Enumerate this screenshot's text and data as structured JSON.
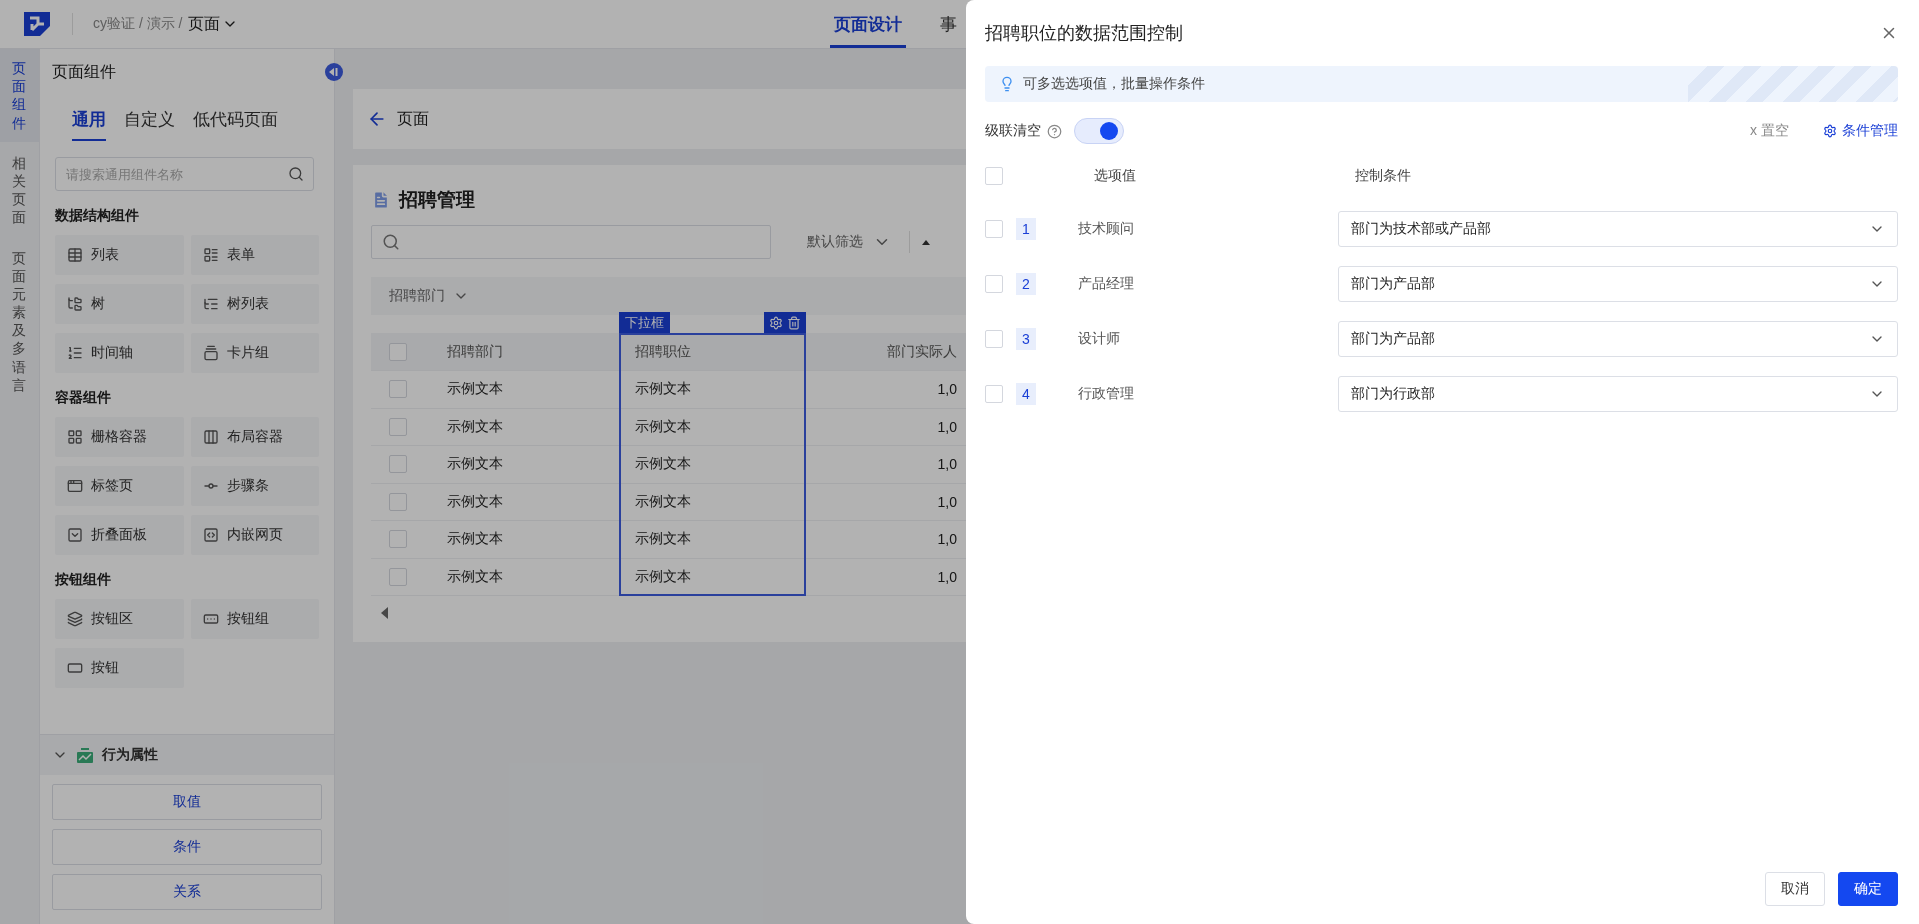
{
  "header": {
    "path": "cy验证 / 演示 /",
    "page": "页面",
    "nav_tabs": [
      {
        "label": "页面设计",
        "selected": true
      },
      {
        "label": "事",
        "selected": false
      }
    ]
  },
  "side_rail": [
    {
      "label": "页面组件",
      "selected": true
    },
    {
      "label": "相关页面",
      "selected": false
    },
    {
      "label": "页面元素及多语言",
      "selected": false
    }
  ],
  "component_panel": {
    "title": "页面组件",
    "tabs": [
      {
        "label": "通用",
        "selected": true
      },
      {
        "label": "自定义",
        "selected": false
      },
      {
        "label": "低代码页面",
        "selected": false
      }
    ],
    "search": {
      "placeholder": "请搜索通用组件名称"
    },
    "groups": [
      {
        "title": "数据结构组件",
        "items": [
          {
            "label": "列表",
            "kind": "table"
          },
          {
            "label": "表单",
            "kind": "form"
          },
          {
            "label": "树",
            "kind": "tree"
          },
          {
            "label": "树列表",
            "kind": "treelist"
          },
          {
            "label": "时间轴",
            "kind": "timeline"
          },
          {
            "label": "卡片组",
            "kind": "cards"
          }
        ]
      },
      {
        "title": "容器组件",
        "items": [
          {
            "label": "栅格容器",
            "kind": "grid"
          },
          {
            "label": "布局容器",
            "kind": "layout"
          },
          {
            "label": "标签页",
            "kind": "tabs"
          },
          {
            "label": "步骤条",
            "kind": "steps"
          },
          {
            "label": "折叠面板",
            "kind": "collapse"
          },
          {
            "label": "内嵌网页",
            "kind": "iframe"
          }
        ]
      },
      {
        "title": "按钮组件",
        "items": [
          {
            "label": "按钮区",
            "kind": "buttonarea"
          },
          {
            "label": "按钮组",
            "kind": "buttongroup"
          },
          {
            "label": "按钮",
            "kind": "button"
          }
        ]
      }
    ]
  },
  "behavior": {
    "title": "行为属性",
    "expanded": true,
    "buttons": [
      "取值",
      "条件",
      "关系"
    ]
  },
  "canvas": {
    "back_label": "页面",
    "title": "招聘管理",
    "filter_label": "默认筛选",
    "filter_field": "招聘部门",
    "selection_tag": "下拉框",
    "table": {
      "columns": [
        "招聘部门",
        "招聘职位",
        "部门实际人"
      ],
      "all_checked": false,
      "rows": [
        {
          "checked": false,
          "cells": [
            "示例文本",
            "示例文本",
            "1,0"
          ]
        },
        {
          "checked": false,
          "cells": [
            "示例文本",
            "示例文本",
            "1,0"
          ]
        },
        {
          "checked": false,
          "cells": [
            "示例文本",
            "示例文本",
            "1,0"
          ]
        },
        {
          "checked": false,
          "cells": [
            "示例文本",
            "示例文本",
            "1,0"
          ]
        },
        {
          "checked": false,
          "cells": [
            "示例文本",
            "示例文本",
            "1,0"
          ]
        },
        {
          "checked": false,
          "cells": [
            "示例文本",
            "示例文本",
            "1,0"
          ]
        }
      ]
    }
  },
  "drawer": {
    "title": "招聘职位的数据范围控制",
    "tip": "可多选选项值，批量操作条件",
    "cascade": {
      "label": "级联清空",
      "on": true
    },
    "clear_label": "x 置空",
    "manage_label": "条件管理",
    "columns": [
      "选项值",
      "控制条件"
    ],
    "all_checked": false,
    "rows": [
      {
        "index": "1",
        "label": "技术顾问",
        "condition": "部门为技术部或产品部",
        "checked": false
      },
      {
        "index": "2",
        "label": "产品经理",
        "condition": "部门为产品部",
        "checked": false
      },
      {
        "index": "3",
        "label": "设计师",
        "condition": "部门为产品部",
        "checked": false
      },
      {
        "index": "4",
        "label": "行政管理",
        "condition": "部门为行政部",
        "checked": false
      }
    ],
    "footer": [
      {
        "label": "取消",
        "kind": "secondary"
      },
      {
        "label": "确定",
        "kind": "primary"
      }
    ]
  }
}
